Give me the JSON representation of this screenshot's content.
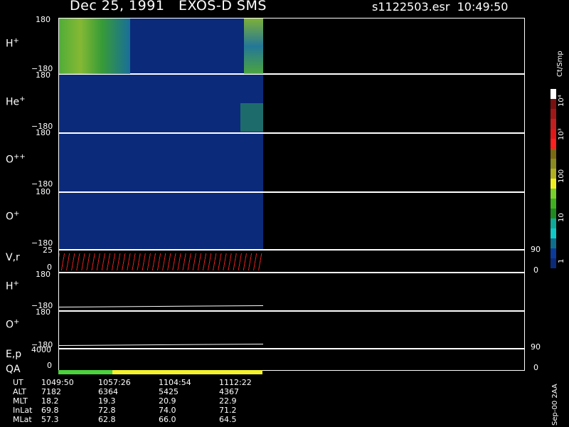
{
  "header": {
    "title": "Dec 25, 1991   EXOS-D SMS",
    "file": "s1122503.esr  10:49:50"
  },
  "panels": {
    "h_plus": {
      "label": "H",
      "sup": "+",
      "top_tick": "180",
      "bottom_tick": "−180"
    },
    "he_plus": {
      "label": "He",
      "sup": "+",
      "top_tick": "180",
      "bottom_tick": "−180"
    },
    "o_plusplus": {
      "label": "O",
      "sup": "++",
      "top_tick": "180",
      "bottom_tick": "−180"
    },
    "o_plus": {
      "label": "O",
      "sup": "+",
      "top_tick": "180",
      "bottom_tick": "−180"
    },
    "vr": {
      "label": "V,r",
      "top_tick": "25",
      "bottom_tick": "0",
      "right_top": "90",
      "right_bottom": "0"
    },
    "h_plus2": {
      "label": "H",
      "sup": "+",
      "top_tick": "180",
      "bottom_tick": "−180"
    },
    "o_plus2": {
      "label": "O",
      "sup": "+",
      "top_tick": "180",
      "bottom_tick": "−180"
    },
    "ep": {
      "label": "E,p",
      "top_tick": "4000",
      "bottom_tick": "0",
      "right_top": "90",
      "right_bottom": "0"
    },
    "qa": {
      "label": "QA"
    }
  },
  "colorbar": {
    "unit": "Ct/Smp",
    "labels": [
      "10⁴",
      "10³",
      "100",
      "10",
      "1"
    ],
    "colors": [
      "#ffffff",
      "#7a1010",
      "#a01818",
      "#c02020",
      "#e01818",
      "#ff2020",
      "#7a6a10",
      "#8a8a20",
      "#b0b020",
      "#f0f020",
      "#78d02a",
      "#40b020",
      "#208a20",
      "#10aa9a",
      "#10c8c8",
      "#0d6e8e",
      "#0b3a9a",
      "#0b2a7a"
    ]
  },
  "footer": {
    "rows": [
      {
        "name": "UT",
        "values": [
          "1049:50",
          "1057:26",
          "1104:54",
          "1112:22"
        ]
      },
      {
        "name": "ALT",
        "values": [
          "7182",
          "6364",
          "5425",
          "4367"
        ]
      },
      {
        "name": "MLT",
        "values": [
          "18.2",
          "19.3",
          "20.9",
          "22.9"
        ]
      },
      {
        "name": "InLat",
        "values": [
          "69.8",
          "72.8",
          "74.0",
          "71.2"
        ]
      },
      {
        "name": "MLat",
        "values": [
          "57.3",
          "62.8",
          "66.0",
          "64.5"
        ]
      }
    ],
    "side": "Sep-00 2AA"
  }
}
